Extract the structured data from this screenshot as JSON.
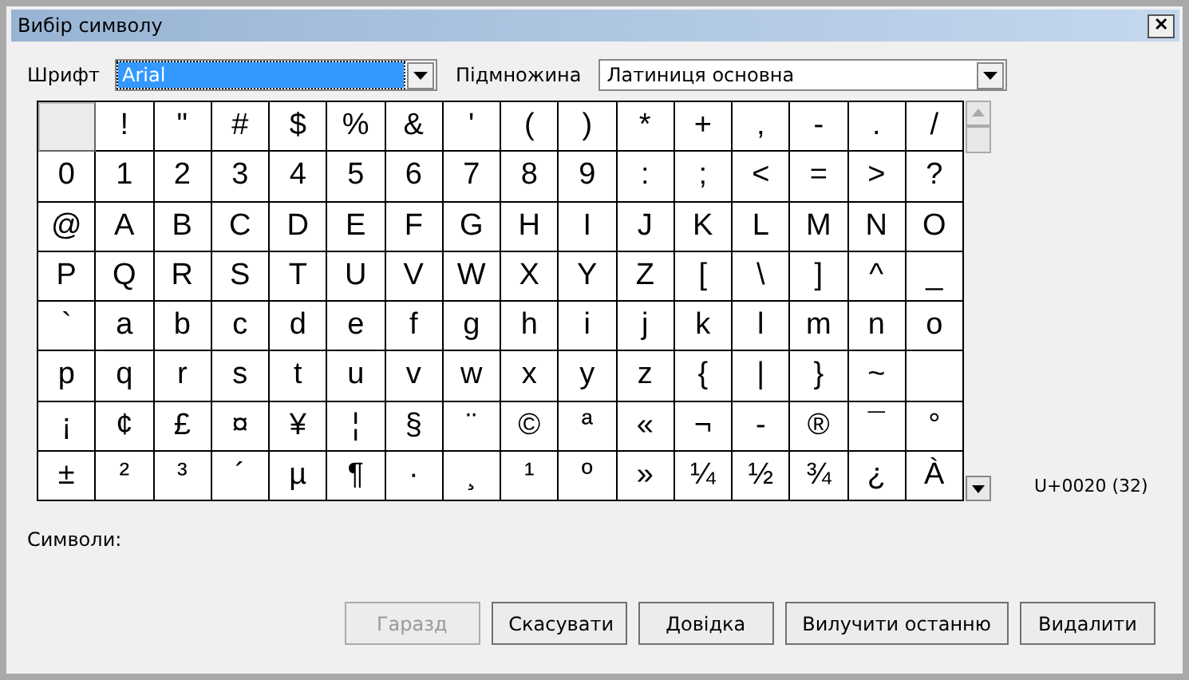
{
  "window": {
    "title": "Вибір символу",
    "close": "✕"
  },
  "font": {
    "label": "Шрифт",
    "value": "Arial",
    "focused": true
  },
  "subset": {
    "label": "Підмножина",
    "value": "Латиниця основна",
    "focused": false
  },
  "grid": [
    [
      {
        "selected": true
      },
      {
        "char": "!",
        "selected": false
      },
      {
        "char": "\"",
        "selected": false
      },
      {
        "char": "#",
        "selected": false
      },
      {
        "char": "$",
        "selected": false
      },
      {
        "char": "%",
        "selected": false
      },
      {
        "char": "&",
        "selected": false
      },
      {
        "char": "'",
        "selected": false
      },
      {
        "char": "(",
        "selected": false
      },
      {
        "char": ")",
        "selected": false
      },
      {
        "char": "*",
        "selected": false
      },
      {
        "char": "+",
        "selected": false
      },
      {
        "char": ",",
        "selected": false
      },
      {
        "char": "-",
        "selected": false
      },
      {
        "char": ".",
        "selected": false
      },
      {
        "char": "/",
        "selected": false
      }
    ],
    [
      {
        "char": "0",
        "selected": false
      },
      {
        "char": "1",
        "selected": false
      },
      {
        "char": "2",
        "selected": false
      },
      {
        "char": "3",
        "selected": false
      },
      {
        "char": "4",
        "selected": false
      },
      {
        "char": "5",
        "selected": false
      },
      {
        "char": "6",
        "selected": false
      },
      {
        "char": "7",
        "selected": false
      },
      {
        "char": "8",
        "selected": false
      },
      {
        "char": "9",
        "selected": false
      },
      {
        "char": ":",
        "selected": false
      },
      {
        "char": ";",
        "selected": false
      },
      {
        "char": "<",
        "selected": false
      },
      {
        "char": "=",
        "selected": false
      },
      {
        "char": ">",
        "selected": false
      },
      {
        "char": "?",
        "selected": false
      }
    ],
    [
      {
        "char": "@",
        "selected": false
      },
      {
        "char": "A",
        "selected": false
      },
      {
        "char": "B",
        "selected": false
      },
      {
        "char": "C",
        "selected": false
      },
      {
        "char": "D",
        "selected": false
      },
      {
        "char": "E",
        "selected": false
      },
      {
        "char": "F",
        "selected": false
      },
      {
        "char": "G",
        "selected": false
      },
      {
        "char": "H",
        "selected": false
      },
      {
        "char": "I",
        "selected": false
      },
      {
        "char": "J",
        "selected": false
      },
      {
        "char": "K",
        "selected": false
      },
      {
        "char": "L",
        "selected": false
      },
      {
        "char": "M",
        "selected": false
      },
      {
        "char": "N",
        "selected": false
      },
      {
        "char": "O",
        "selected": false
      }
    ],
    [
      {
        "char": "P",
        "selected": false
      },
      {
        "char": "Q",
        "selected": false
      },
      {
        "char": "R",
        "selected": false
      },
      {
        "char": "S",
        "selected": false
      },
      {
        "char": "T",
        "selected": false
      },
      {
        "char": "U",
        "selected": false
      },
      {
        "char": "V",
        "selected": false
      },
      {
        "char": "W",
        "selected": false
      },
      {
        "char": "X",
        "selected": false
      },
      {
        "char": "Y",
        "selected": false
      },
      {
        "char": "Z",
        "selected": false
      },
      {
        "char": "[",
        "selected": false
      },
      {
        "char": "\\",
        "selected": false
      },
      {
        "char": "]",
        "selected": false
      },
      {
        "char": "^",
        "selected": false
      },
      {
        "char": "_",
        "selected": false
      }
    ],
    [
      {
        "char": "`",
        "selected": false
      },
      {
        "char": "a",
        "selected": false
      },
      {
        "char": "b",
        "selected": false
      },
      {
        "char": "c",
        "selected": false
      },
      {
        "char": "d",
        "selected": false
      },
      {
        "char": "e",
        "selected": false
      },
      {
        "char": "f",
        "selected": false
      },
      {
        "char": "g",
        "selected": false
      },
      {
        "char": "h",
        "selected": false
      },
      {
        "char": "i",
        "selected": false
      },
      {
        "char": "j",
        "selected": false
      },
      {
        "char": "k",
        "selected": false
      },
      {
        "char": "l",
        "selected": false
      },
      {
        "char": "m",
        "selected": false
      },
      {
        "char": "n",
        "selected": false
      },
      {
        "char": "o",
        "selected": false
      }
    ],
    [
      {
        "char": "p",
        "selected": false
      },
      {
        "char": "q",
        "selected": false
      },
      {
        "char": "r",
        "selected": false
      },
      {
        "char": "s",
        "selected": false
      },
      {
        "char": "t",
        "selected": false
      },
      {
        "char": "u",
        "selected": false
      },
      {
        "char": "v",
        "selected": false
      },
      {
        "char": "w",
        "selected": false
      },
      {
        "char": "x",
        "selected": false
      },
      {
        "char": "y",
        "selected": false
      },
      {
        "char": "z",
        "selected": false
      },
      {
        "char": "{",
        "selected": false
      },
      {
        "char": "|",
        "selected": false
      },
      {
        "char": "}",
        "selected": false
      },
      {
        "char": "~",
        "selected": false
      },
      {
        "selected": false
      }
    ],
    [
      {
        "char": "¡",
        "selected": false
      },
      {
        "char": "¢",
        "selected": false
      },
      {
        "char": "£",
        "selected": false
      },
      {
        "char": "¤",
        "selected": false
      },
      {
        "char": "¥",
        "selected": false
      },
      {
        "char": "¦",
        "selected": false
      },
      {
        "char": "§",
        "selected": false
      },
      {
        "char": "¨",
        "selected": false
      },
      {
        "char": "©",
        "selected": false
      },
      {
        "char": "ª",
        "selected": false
      },
      {
        "char": "«",
        "selected": false
      },
      {
        "char": "¬",
        "selected": false
      },
      {
        "char": "-",
        "selected": false
      },
      {
        "char": "®",
        "selected": false
      },
      {
        "char": "¯",
        "selected": false
      },
      {
        "char": "°",
        "selected": false
      }
    ],
    [
      {
        "char": "±",
        "selected": false
      },
      {
        "char": "²",
        "selected": false
      },
      {
        "char": "³",
        "selected": false
      },
      {
        "char": "´",
        "selected": false
      },
      {
        "char": "µ",
        "selected": false
      },
      {
        "char": "¶",
        "selected": false
      },
      {
        "char": "·",
        "selected": false
      },
      {
        "char": "¸",
        "selected": false
      },
      {
        "char": "¹",
        "selected": false
      },
      {
        "char": "º",
        "selected": false
      },
      {
        "char": "»",
        "selected": false
      },
      {
        "char": "¼",
        "selected": false
      },
      {
        "char": "½",
        "selected": false
      },
      {
        "char": "¾",
        "selected": false
      },
      {
        "char": "¿",
        "selected": false
      },
      {
        "char": "À",
        "selected": false
      }
    ]
  ],
  "code": "U+0020 (32)",
  "symbols_label": "Символи:",
  "buttons": [
    {
      "label": "Гаразд",
      "disabled": true
    },
    {
      "label": "Скасувати",
      "disabled": false
    },
    {
      "label": "Довідка",
      "disabled": false
    },
    {
      "label": "Вилучити останню",
      "disabled": false
    },
    {
      "label": "Видалити",
      "disabled": false
    }
  ]
}
